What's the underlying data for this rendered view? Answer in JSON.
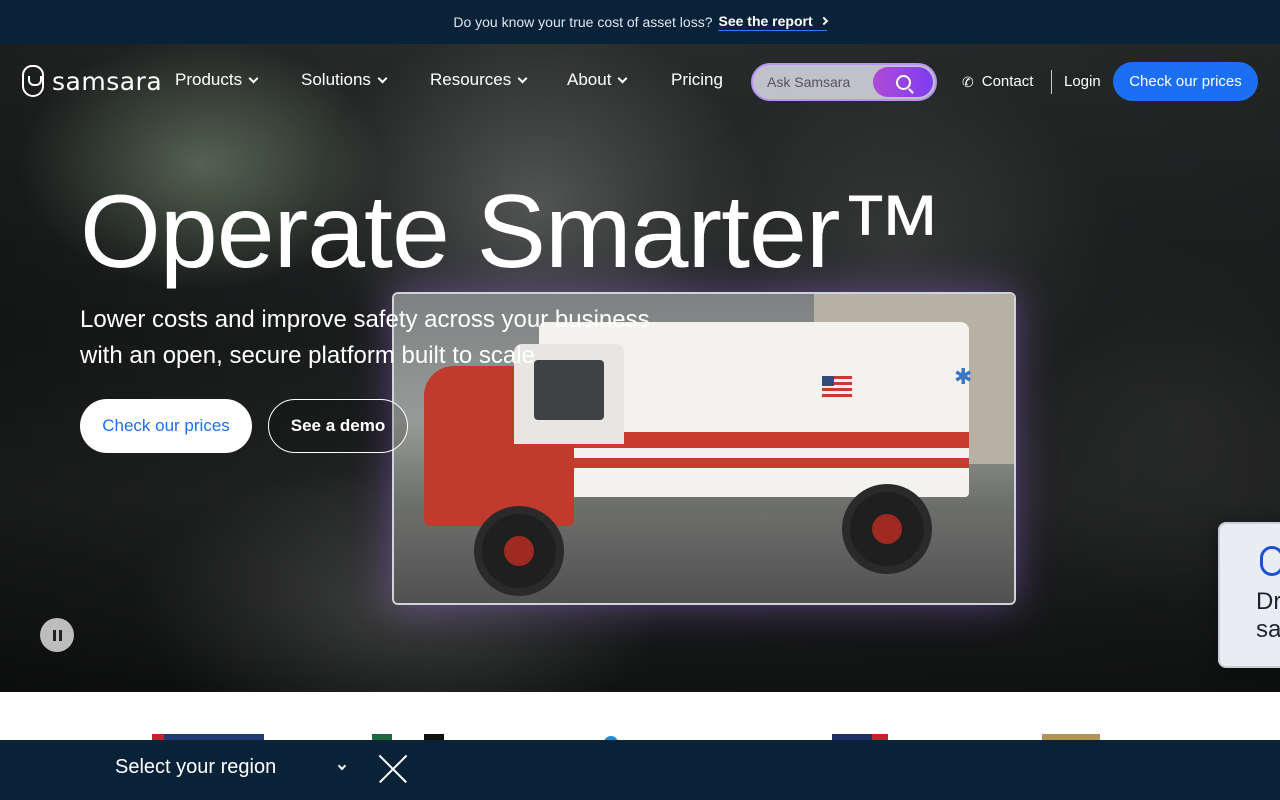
{
  "banner": {
    "text": "Do you know your true cost of asset loss?",
    "link_label": "See the report"
  },
  "nav": {
    "logo_text": "samsara",
    "items": [
      {
        "label": "Products",
        "has_dropdown": true
      },
      {
        "label": "Solutions",
        "has_dropdown": true
      },
      {
        "label": "Resources",
        "has_dropdown": true
      },
      {
        "label": "About",
        "has_dropdown": true
      },
      {
        "label": "Pricing",
        "has_dropdown": false
      }
    ],
    "search_placeholder": "Ask Samsara",
    "contact_label": "Contact",
    "login_label": "Login",
    "cta_label": "Check our prices"
  },
  "hero": {
    "title": "Operate Smarter™",
    "subtitle": "Lower costs and improve safety across your business with an open, secure platform built to scale",
    "primary_cta": "Check our prices",
    "secondary_cta": "See a demo",
    "side_card_text": "Dr sa"
  },
  "region": {
    "select_label": "Select your region"
  },
  "colors": {
    "brand_blue": "#1a6ff5",
    "banner_navy": "#0a2238",
    "search_accent": "#b794f6"
  },
  "icons": {
    "phone": "phone-icon",
    "search": "ai-search-icon",
    "pause": "pause-icon",
    "close": "close-icon"
  }
}
